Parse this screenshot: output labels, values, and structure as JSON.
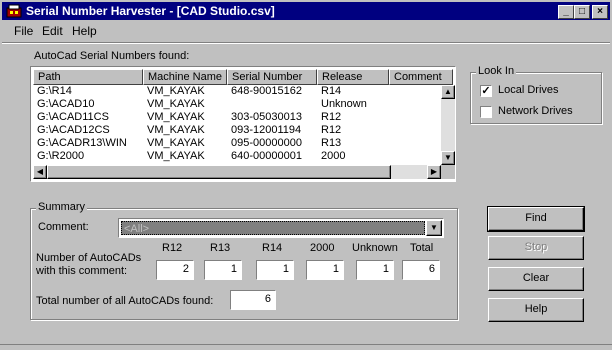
{
  "window": {
    "title": "Serial Number Harvester - [CAD Studio.csv]",
    "controls": {
      "minimize": "_",
      "maximize": "□",
      "close": "×"
    }
  },
  "menu": [
    "File",
    "Edit",
    "Help"
  ],
  "serials_label": "AutoCad Serial Numbers found:",
  "table": {
    "columns": [
      "Path",
      "Machine Name",
      "Serial Number",
      "Release",
      "Comment"
    ],
    "rows": [
      [
        "G:\\R14",
        "VM_KAYAK",
        "648-90015162",
        "R14",
        ""
      ],
      [
        "G:\\ACAD10",
        "VM_KAYAK",
        "",
        "Unknown",
        ""
      ],
      [
        "G:\\ACAD11CS",
        "VM_KAYAK",
        "303-05030013",
        "R12",
        ""
      ],
      [
        "G:\\ACAD12CS",
        "VM_KAYAK",
        "093-12001194",
        "R12",
        ""
      ],
      [
        "G:\\ACADR13\\WIN",
        "VM_KAYAK",
        "095-00000000",
        "R13",
        ""
      ],
      [
        "G:\\R2000",
        "VM_KAYAK",
        "640-00000001",
        "2000",
        ""
      ]
    ]
  },
  "look_in": {
    "title": "Look In",
    "local_drives": {
      "label": "Local Drives",
      "checked": true
    },
    "network_drives": {
      "label": "Network Drives",
      "checked": false
    }
  },
  "summary": {
    "title": "Summary",
    "comment_label": "Comment:",
    "comment_value": "<All>",
    "count_label_line1": "Number of AutoCADs",
    "count_label_line2": "with this comment:",
    "release_headers": [
      "R12",
      "R13",
      "R14",
      "2000",
      "Unknown",
      "Total"
    ],
    "counts": [
      "2",
      "1",
      "1",
      "1",
      "1",
      "6"
    ],
    "total_label": "Total number of all AutoCADs found:",
    "total_value": "6"
  },
  "buttons": {
    "find": "Find",
    "stop": "Stop",
    "clear": "Clear",
    "help": "Help"
  }
}
